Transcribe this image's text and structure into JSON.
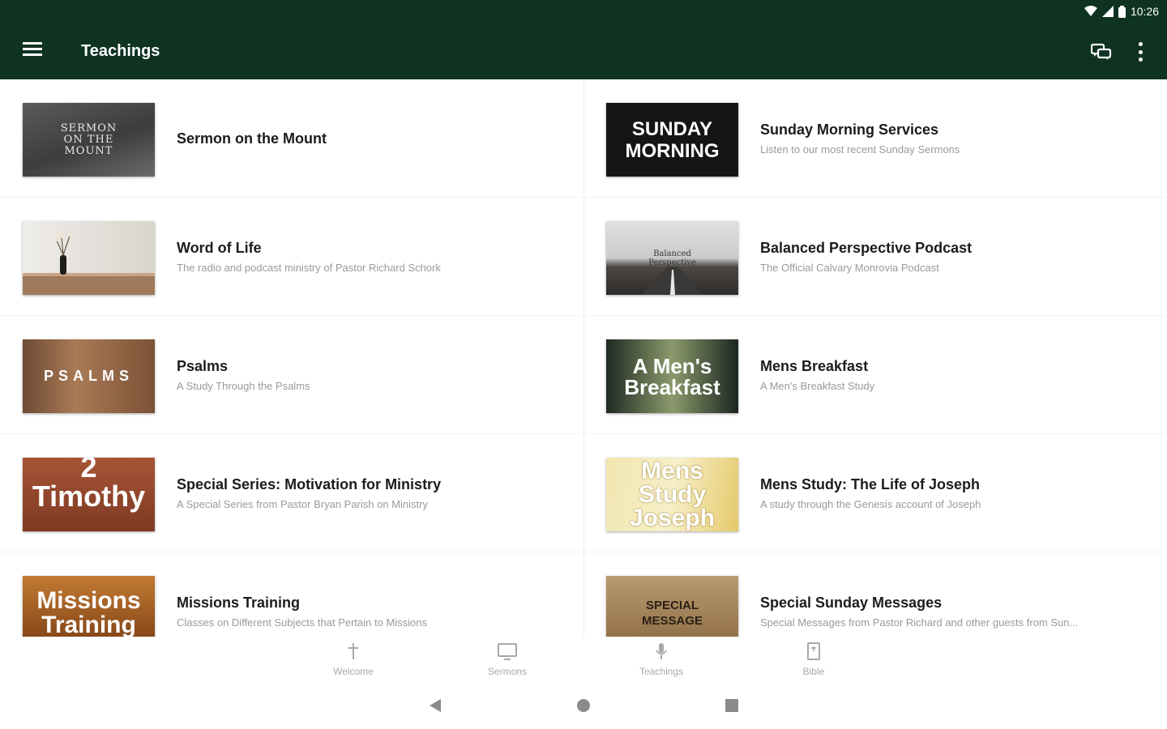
{
  "status_bar": {
    "time": "10:26"
  },
  "app_bar": {
    "title": "Teachings"
  },
  "teachings": [
    {
      "title": "Sermon on the Mount",
      "subtitle": "",
      "thumb_text": "SERMON ON THE MOUNT"
    },
    {
      "title": "Sunday Morning Services",
      "subtitle": "Listen to our most recent Sunday Sermons",
      "thumb_text": "SUNDAY MORNING"
    },
    {
      "title": "Word of Life",
      "subtitle": "The radio and podcast ministry of Pastor Richard Schork",
      "thumb_text": ""
    },
    {
      "title": "Balanced Perspective Podcast",
      "subtitle": "The Official Calvary Monrovia Podcast",
      "thumb_text": "Balanced Perspective"
    },
    {
      "title": "Psalms",
      "subtitle": "A Study Through the Psalms",
      "thumb_text": "PSALMS"
    },
    {
      "title": "Mens Breakfast",
      "subtitle": "A Men's Breakfast Study",
      "thumb_text": "A Men's Breakfast"
    },
    {
      "title": "Special Series: Motivation for Ministry",
      "subtitle": "A Special Series from Pastor Bryan Parish on Ministry",
      "thumb_text": "2 Timothy"
    },
    {
      "title": "Mens Study: The Life of Joseph",
      "subtitle": "A study through the Genesis account of Joseph",
      "thumb_text": "Mens Study Joseph"
    },
    {
      "title": "Missions Training",
      "subtitle": "Classes on Different Subjects that Pertain to Missions",
      "thumb_text": "Missions Training"
    },
    {
      "title": "Special Sunday Messages",
      "subtitle": "Special Messages from Pastor Richard and other guests from Sun...",
      "thumb_text": "SPECIAL MESSAGE"
    }
  ],
  "bottom_nav": [
    {
      "label": "Welcome",
      "icon": "cross-icon"
    },
    {
      "label": "Sermons",
      "icon": "monitor-icon"
    },
    {
      "label": "Teachings",
      "icon": "microphone-icon"
    },
    {
      "label": "Bible",
      "icon": "book-icon"
    }
  ],
  "colors": {
    "app_bar": "#0f3323",
    "active_nav": "#a8a8a8"
  }
}
